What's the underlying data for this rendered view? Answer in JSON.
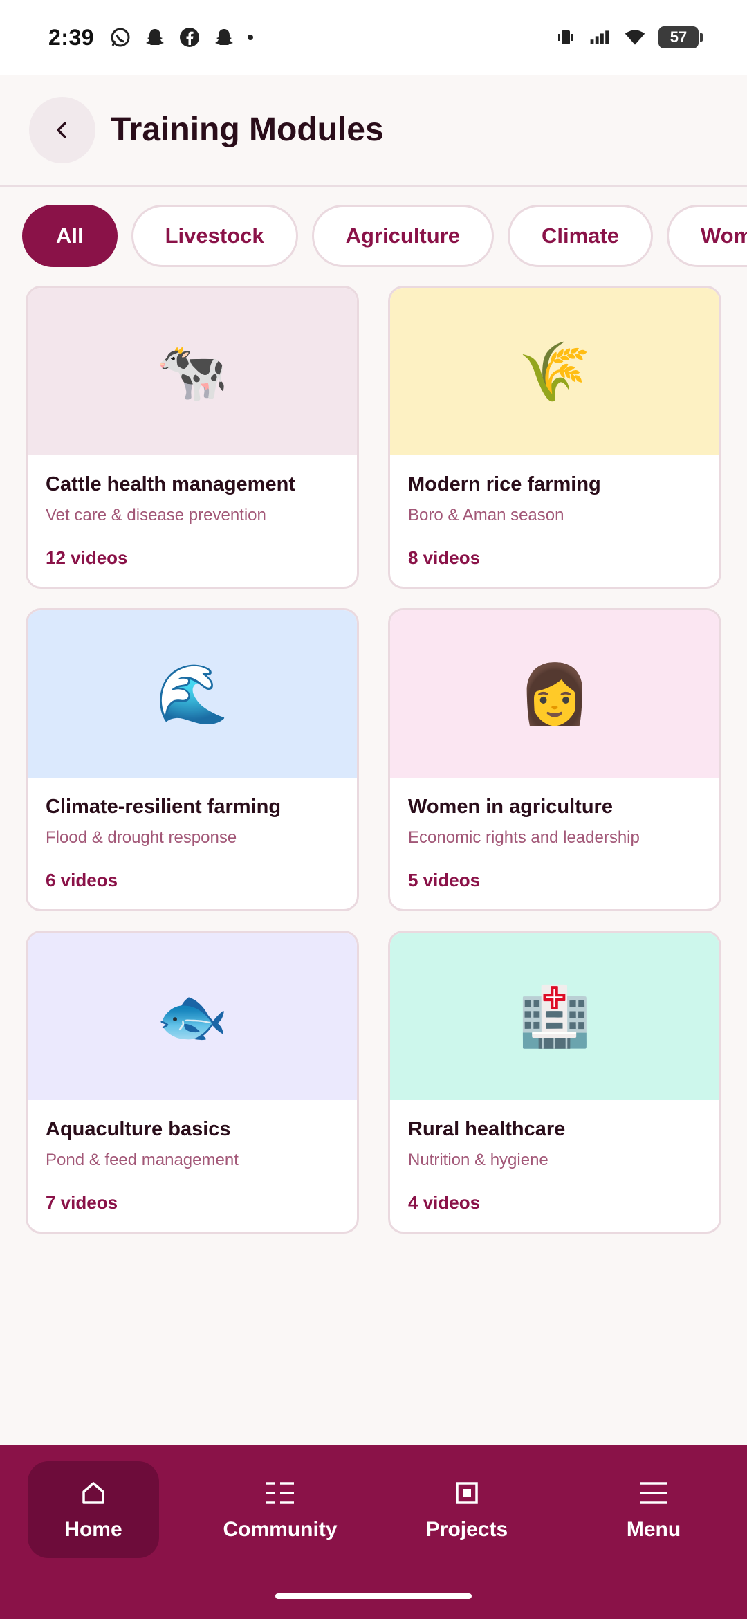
{
  "status_bar": {
    "time": "2:39",
    "battery": "57",
    "left_icons": [
      "whatsapp-icon",
      "snapchat-icon",
      "facebook-icon",
      "snapchat-icon"
    ],
    "right_icons": [
      "vibrate-icon",
      "signal-icon",
      "wifi-icon",
      "battery-icon"
    ]
  },
  "header": {
    "title": "Training Modules",
    "back_icon": "chevron-left-icon"
  },
  "filters": [
    {
      "label": "All",
      "active": true
    },
    {
      "label": "Livestock",
      "active": false
    },
    {
      "label": "Agriculture",
      "active": false
    },
    {
      "label": "Climate",
      "active": false
    },
    {
      "label": "Wom",
      "active": false
    }
  ],
  "modules": [
    {
      "title": "Cattle health management",
      "subtitle": "Vet care & disease prevention",
      "count": "12 videos",
      "emoji": "🐄",
      "bg": "#f3e6ec"
    },
    {
      "title": "Modern rice farming",
      "subtitle": "Boro & Aman season",
      "count": "8 videos",
      "emoji": "🌾",
      "bg": "#fdf1c3"
    },
    {
      "title": "Climate-resilient farming",
      "subtitle": "Flood & drought response",
      "count": "6 videos",
      "emoji": "🌊",
      "bg": "#dbe9fd"
    },
    {
      "title": "Women in agriculture",
      "subtitle": "Economic rights and leadership",
      "count": "5 videos",
      "emoji": "👩",
      "bg": "#fbe6f2"
    },
    {
      "title": "Aquaculture basics",
      "subtitle": "Pond & feed management",
      "count": "7 videos",
      "emoji": "🐟",
      "bg": "#ebe9fd"
    },
    {
      "title": "Rural healthcare",
      "subtitle": "Nutrition & hygiene",
      "count": "4 videos",
      "emoji": "🏥",
      "bg": "#cdf7ec"
    }
  ],
  "bottom_nav": [
    {
      "label": "Home",
      "icon": "home-icon",
      "active": true
    },
    {
      "label": "Community",
      "icon": "list-icon",
      "active": false
    },
    {
      "label": "Projects",
      "icon": "square-icon",
      "active": false
    },
    {
      "label": "Menu",
      "icon": "menu-icon",
      "active": false
    }
  ],
  "colors": {
    "brand": "#8a1248",
    "brand_dark": "#6d0c3a",
    "subtitle": "#a25777"
  }
}
